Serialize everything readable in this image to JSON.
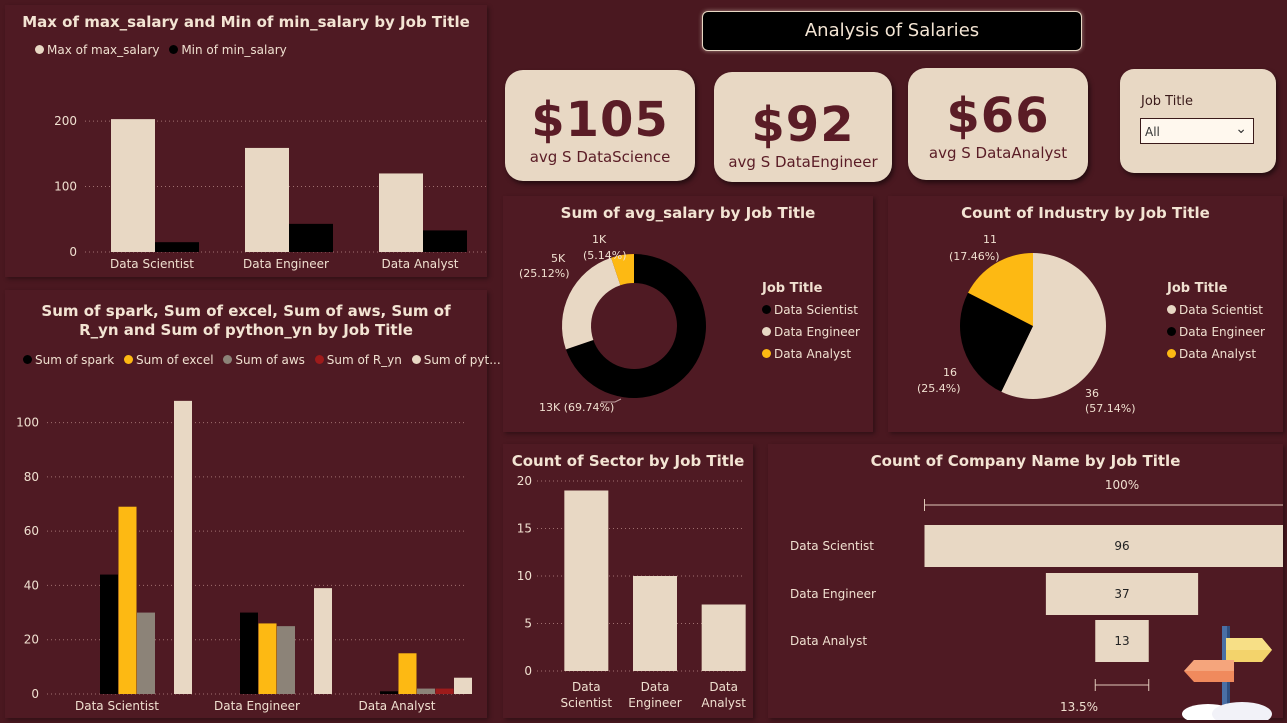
{
  "dashboard": {
    "title": "Analysis of  Salaries",
    "cards": [
      {
        "value": "$105",
        "label": "avg S DataScience"
      },
      {
        "value": "$92",
        "label": "avg S DataEngineer"
      },
      {
        "value": "$66",
        "label": "avg S DataAnalyst"
      }
    ],
    "slicer": {
      "label": "Job Title",
      "selected": "All"
    }
  },
  "chart_data": [
    {
      "type": "bar",
      "title": "Max of max_salary and Min of min_salary by Job Title",
      "categories": [
        "Data Scientist",
        "Data Engineer",
        "Data Analyst"
      ],
      "series": [
        {
          "name": "Max of max_salary",
          "values": [
            203,
            159,
            120
          ],
          "color": "#e8d8c4"
        },
        {
          "name": "Min of min_salary",
          "values": [
            15,
            43,
            33
          ],
          "color": "#000000"
        }
      ],
      "yticks": [
        "0",
        "100",
        "200"
      ],
      "ylim": [
        0,
        220
      ]
    },
    {
      "type": "bar",
      "title": "Sum of spark, Sum of excel, Sum of aws, Sum of R_yn and Sum of python_yn by Job Title",
      "categories": [
        "Data Scientist",
        "Data Engineer",
        "Data Analyst"
      ],
      "series": [
        {
          "name": "Sum of spark",
          "values": [
            44,
            30,
            1
          ],
          "color": "#000000"
        },
        {
          "name": "Sum of excel",
          "values": [
            69,
            26,
            15
          ],
          "color": "#fdb913"
        },
        {
          "name": "Sum of aws",
          "values": [
            30,
            25,
            2
          ],
          "color": "#8c8378"
        },
        {
          "name": "Sum of R_yn",
          "values": [
            0,
            0,
            2
          ],
          "color": "#9e1b1b"
        },
        {
          "name": "Sum of pyt...",
          "values": [
            108,
            39,
            6
          ],
          "color": "#e8d8c4"
        }
      ],
      "yticks": [
        "0",
        "20",
        "40",
        "60",
        "80",
        "100"
      ],
      "ylim": [
        0,
        112
      ]
    },
    {
      "type": "pie",
      "variant": "donut",
      "title": "Sum of avg_salary by Job Title",
      "legend_title": "Job Title",
      "categories": [
        "Data Scientist",
        "Data Engineer",
        "Data Analyst"
      ],
      "values": [
        69.74,
        25.12,
        5.14
      ],
      "colors": [
        "#000000",
        "#e8d8c4",
        "#fdb913"
      ],
      "labels": [
        "13K (69.74%)",
        "5K",
        "(25.12%)",
        "1K",
        "(5.14%)"
      ]
    },
    {
      "type": "pie",
      "title": "Count of Industry by Job Title",
      "legend_title": "Job Title",
      "categories": [
        "Data Scientist",
        "Data Engineer",
        "Data Analyst"
      ],
      "values": [
        36,
        16,
        11
      ],
      "colors": [
        "#e8d8c4",
        "#000000",
        "#fdb913"
      ],
      "labels": [
        "36",
        "(57.14%)",
        "16",
        "(25.4%)",
        "11",
        "(17.46%)"
      ]
    },
    {
      "type": "bar",
      "title": "Count of Sector by Job Title",
      "categories": [
        "Data Scientist",
        "Data Engineer",
        "Data Analyst"
      ],
      "category_lines": [
        [
          "Data",
          "Scientist"
        ],
        [
          "Data",
          "Engineer"
        ],
        [
          "Data",
          "Analyst"
        ]
      ],
      "values": [
        19,
        10,
        7
      ],
      "yticks": [
        "0",
        "5",
        "10",
        "15",
        "20"
      ],
      "ylim": [
        0,
        20
      ]
    },
    {
      "type": "bar",
      "variant": "funnel",
      "title": "Count of Company Name by Job Title",
      "categories": [
        "Data Scientist",
        "Data Engineer",
        "Data Analyst"
      ],
      "values": [
        96,
        37,
        13
      ],
      "top_label": "100%",
      "bottom_label": "13.5%"
    }
  ]
}
